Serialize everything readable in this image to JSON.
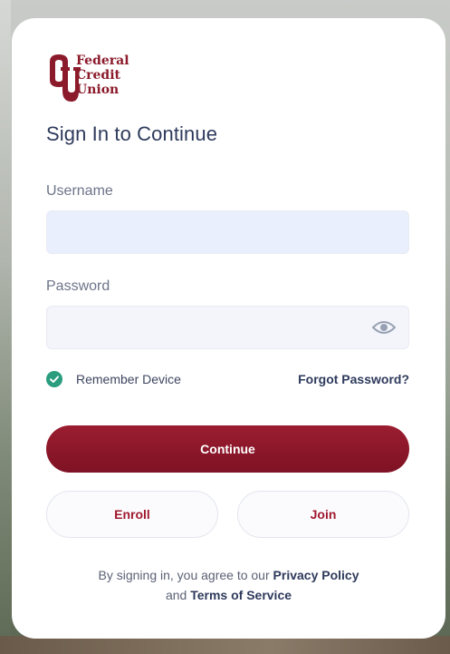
{
  "brand": {
    "logo_line1": "Federal",
    "logo_line2": "Credit",
    "logo_line3": "Union",
    "primary_color": "#8b1a2b",
    "logo_icon": "ou-monogram-icon"
  },
  "form": {
    "heading": "Sign In to Continue",
    "username_label": "Username",
    "username_value": "",
    "password_label": "Password",
    "password_value": "",
    "remember_label": "Remember Device",
    "remember_checked": true,
    "forgot_label": "Forgot Password?",
    "continue_label": "Continue",
    "enroll_label": "Enroll",
    "join_label": "Join"
  },
  "legal": {
    "prefix": "By signing in, you agree to our",
    "privacy_label": "Privacy Policy",
    "and_text": "and",
    "terms_label": "Terms of Service"
  },
  "icons": {
    "password_toggle": "eye-icon",
    "remember_check": "check-circle-icon"
  },
  "colors": {
    "accent": "#8b1a2b",
    "check": "#2a9d7f",
    "heading": "#2e3a5c"
  }
}
